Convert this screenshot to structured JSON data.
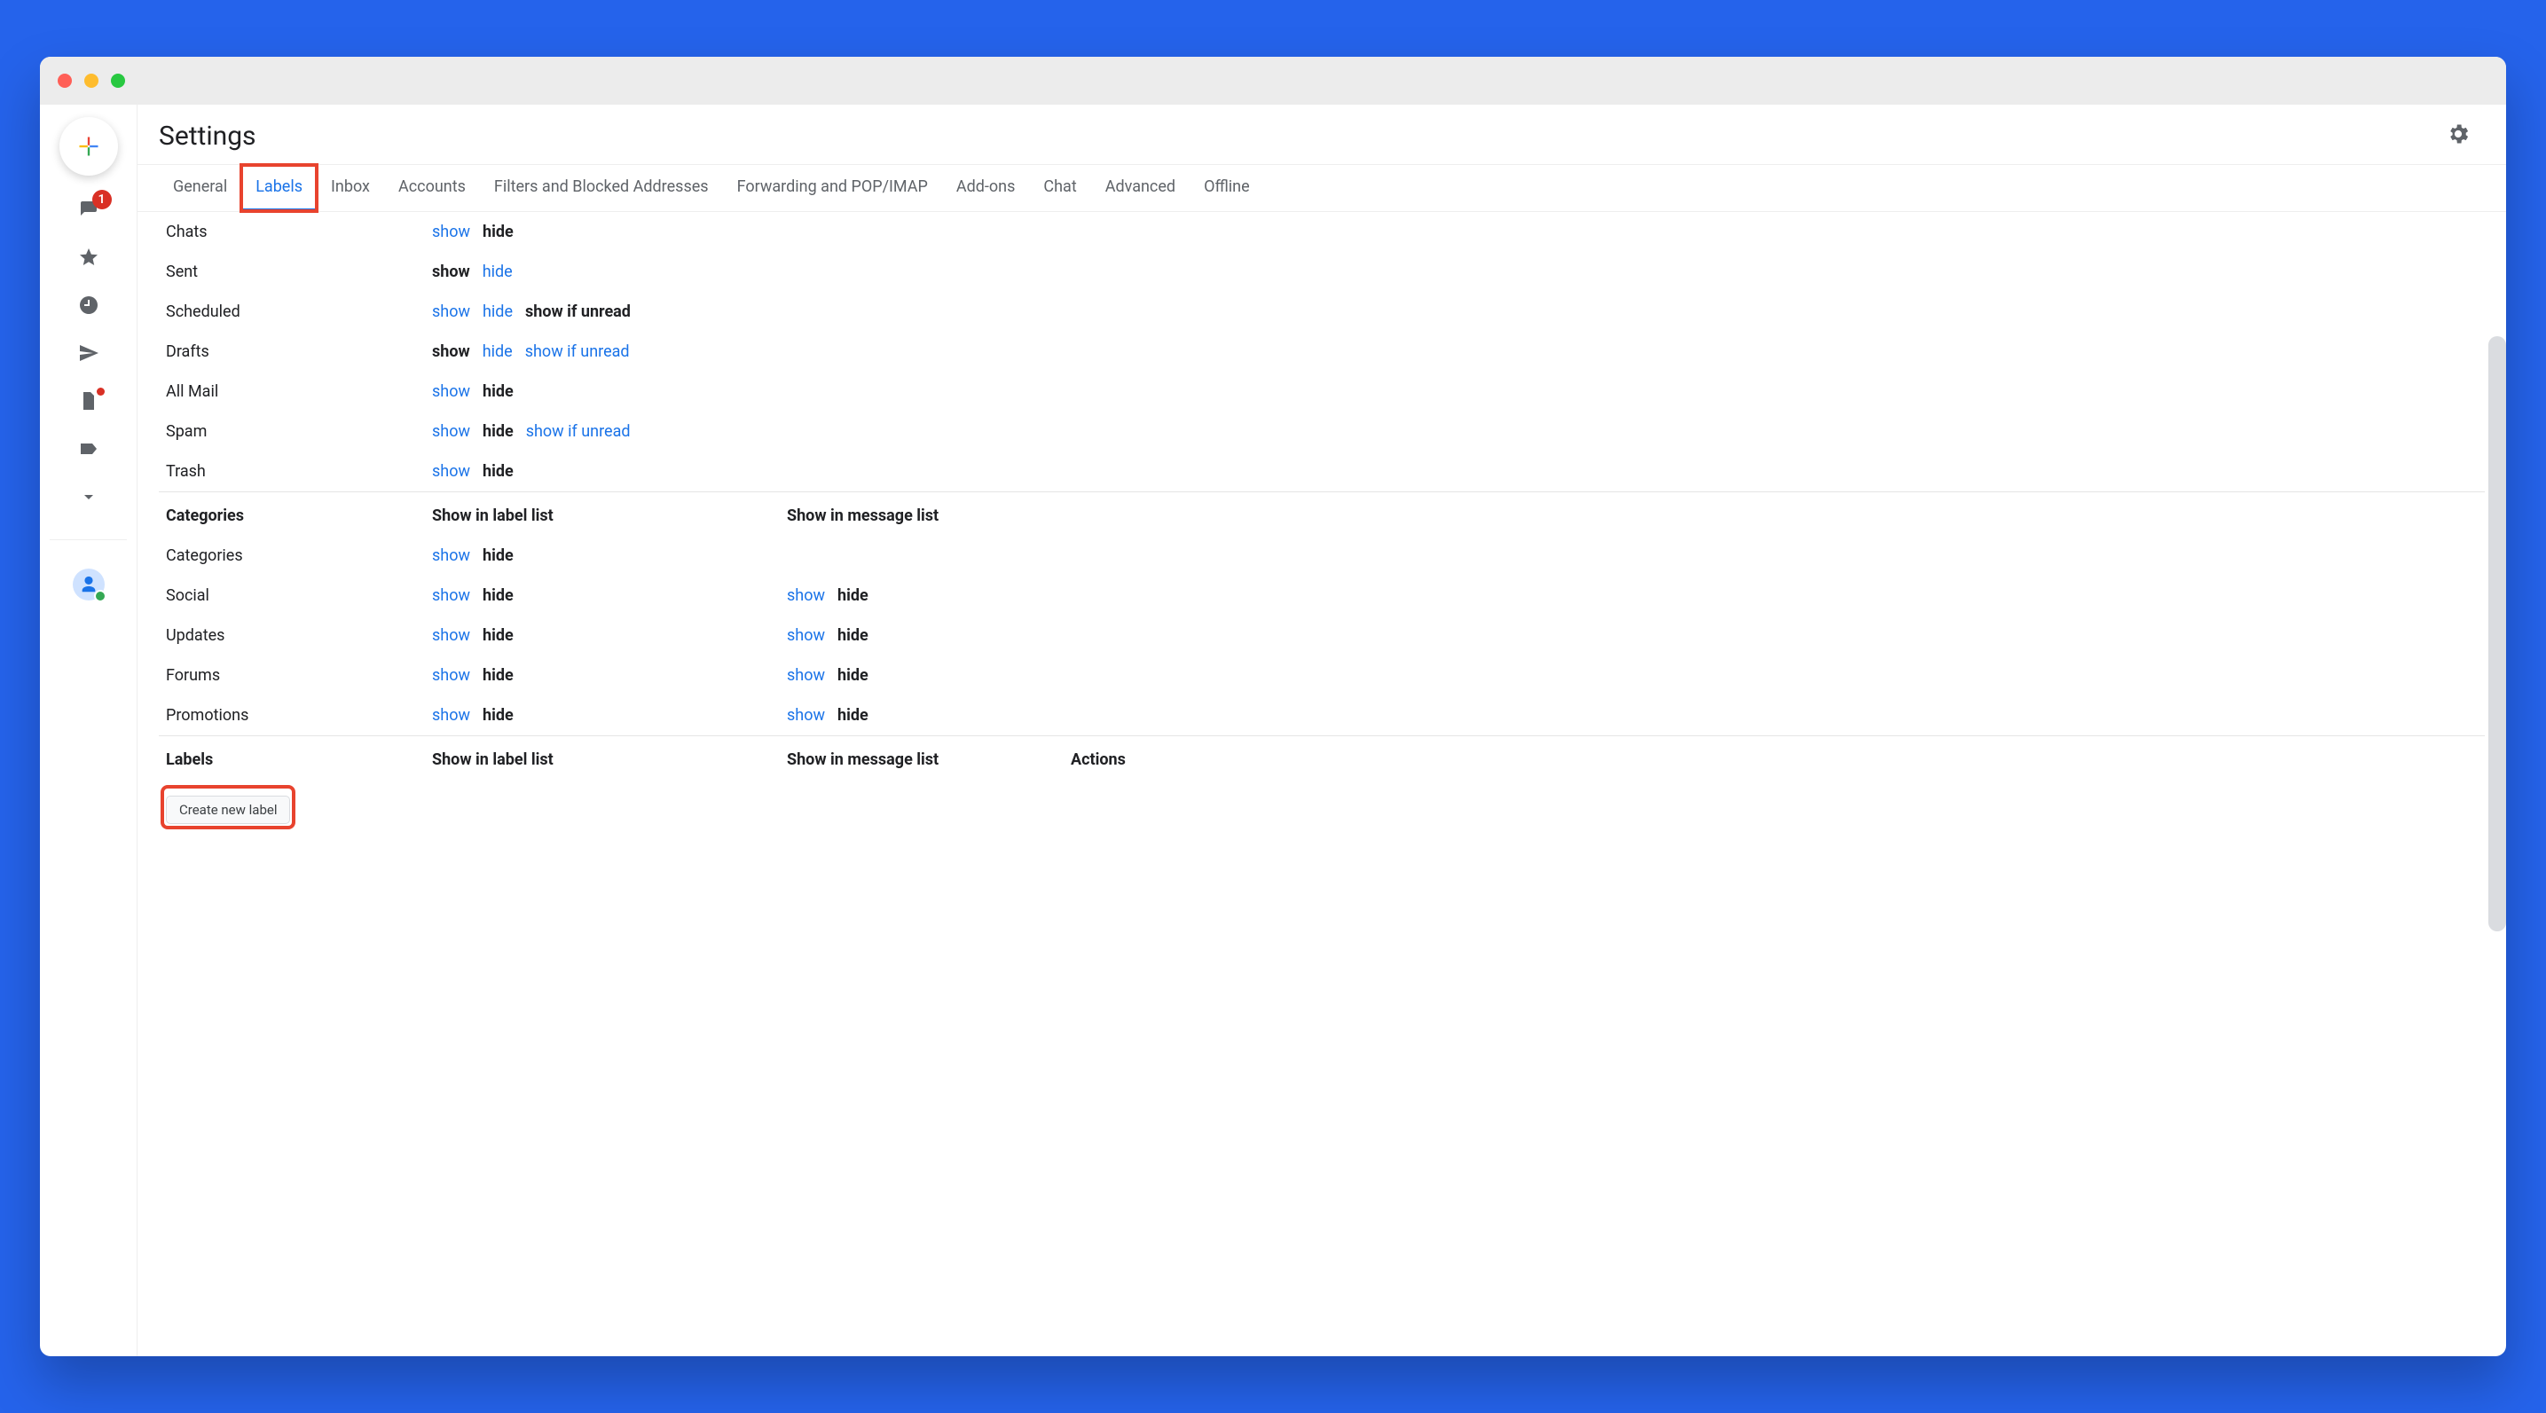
{
  "header": {
    "title": "Settings"
  },
  "sidebar": {
    "inbox_badge": "1"
  },
  "tabs": [
    {
      "label": "General",
      "active": false,
      "highlight": false
    },
    {
      "label": "Labels",
      "active": true,
      "highlight": true
    },
    {
      "label": "Inbox",
      "active": false,
      "highlight": false
    },
    {
      "label": "Accounts",
      "active": false,
      "highlight": false
    },
    {
      "label": "Filters and Blocked Addresses",
      "active": false,
      "highlight": false
    },
    {
      "label": "Forwarding and POP/IMAP",
      "active": false,
      "highlight": false
    },
    {
      "label": "Add-ons",
      "active": false,
      "highlight": false
    },
    {
      "label": "Chat",
      "active": false,
      "highlight": false
    },
    {
      "label": "Advanced",
      "active": false,
      "highlight": false
    },
    {
      "label": "Offline",
      "active": false,
      "highlight": false
    }
  ],
  "strings": {
    "show": "show",
    "hide": "hide",
    "show_if_unread": "show if unread",
    "show_in_label_list": "Show in label list",
    "show_in_message_list": "Show in message list",
    "actions": "Actions",
    "create_new_label": "Create new label"
  },
  "system_labels": [
    {
      "name": "Chats",
      "label_list": {
        "selected": "hide",
        "options": [
          "show",
          "hide"
        ]
      }
    },
    {
      "name": "Sent",
      "label_list": {
        "selected": "show",
        "options": [
          "show",
          "hide"
        ]
      }
    },
    {
      "name": "Scheduled",
      "label_list": {
        "selected": "show_if_unread",
        "options": [
          "show",
          "hide",
          "show_if_unread"
        ]
      }
    },
    {
      "name": "Drafts",
      "label_list": {
        "selected": "show",
        "options": [
          "show",
          "hide",
          "show_if_unread"
        ]
      }
    },
    {
      "name": "All Mail",
      "label_list": {
        "selected": "hide",
        "options": [
          "show",
          "hide"
        ]
      }
    },
    {
      "name": "Spam",
      "label_list": {
        "selected": "hide",
        "options": [
          "show",
          "hide",
          "show_if_unread"
        ]
      }
    },
    {
      "name": "Trash",
      "label_list": {
        "selected": "hide",
        "options": [
          "show",
          "hide"
        ]
      }
    }
  ],
  "categories_section": {
    "title": "Categories",
    "rows": [
      {
        "name": "Categories",
        "label_list": {
          "selected": "hide",
          "options": [
            "show",
            "hide"
          ]
        },
        "message_list": null
      },
      {
        "name": "Social",
        "label_list": {
          "selected": "hide",
          "options": [
            "show",
            "hide"
          ]
        },
        "message_list": {
          "selected": "hide",
          "options": [
            "show",
            "hide"
          ]
        }
      },
      {
        "name": "Updates",
        "label_list": {
          "selected": "hide",
          "options": [
            "show",
            "hide"
          ]
        },
        "message_list": {
          "selected": "hide",
          "options": [
            "show",
            "hide"
          ]
        }
      },
      {
        "name": "Forums",
        "label_list": {
          "selected": "hide",
          "options": [
            "show",
            "hide"
          ]
        },
        "message_list": {
          "selected": "hide",
          "options": [
            "show",
            "hide"
          ]
        }
      },
      {
        "name": "Promotions",
        "label_list": {
          "selected": "hide",
          "options": [
            "show",
            "hide"
          ]
        },
        "message_list": {
          "selected": "hide",
          "options": [
            "show",
            "hide"
          ]
        }
      }
    ]
  },
  "user_labels_section": {
    "title": "Labels",
    "highlight_create": true
  }
}
